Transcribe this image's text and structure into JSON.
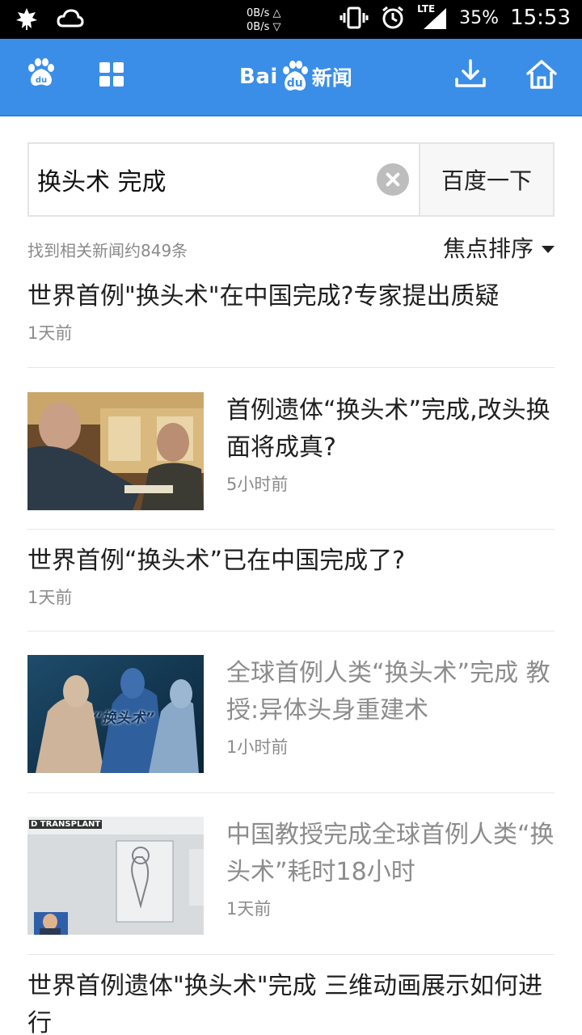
{
  "status_bar": {
    "net_up": "0B/s △",
    "net_down": "0B/s ▽",
    "network": "LTE",
    "battery": "35%",
    "time": "15:53"
  },
  "header": {
    "logo_bai": "Bai",
    "logo_du": "du",
    "logo_news": "新闻",
    "icons": [
      "paw-icon",
      "grid-icon",
      "download-icon",
      "home-icon"
    ]
  },
  "search": {
    "query": "换头术 完成",
    "button_label": "百度一下"
  },
  "results": {
    "count_text": "找到相关新闻约849条",
    "sort_label": "焦点排序"
  },
  "news": [
    {
      "title": "世界首例\"换头术\"在中国完成?专家提出质疑",
      "time": "1天前"
    },
    {
      "title": "首例遗体“换头术”完成,改头换面将成真?",
      "time": "5小时前"
    },
    {
      "title": "世界首例“换头术”已在中国完成了?",
      "time": "1天前"
    },
    {
      "title": "全球首例人类“换头术”完成 教授:异体头身重建术",
      "time": "1小时前",
      "image_caption": "“换头术”"
    },
    {
      "title": "中国教授完成全球首例人类“换头术”耗时18小时",
      "time": "1天前",
      "image_caption": "D TRANSPLANT"
    },
    {
      "title": "世界首例遗体\"换头术\"完成 三维动画展示如何进行"
    }
  ],
  "colors": {
    "header_blue": "#3a8ee8",
    "read_title": "#8c8c8c"
  }
}
